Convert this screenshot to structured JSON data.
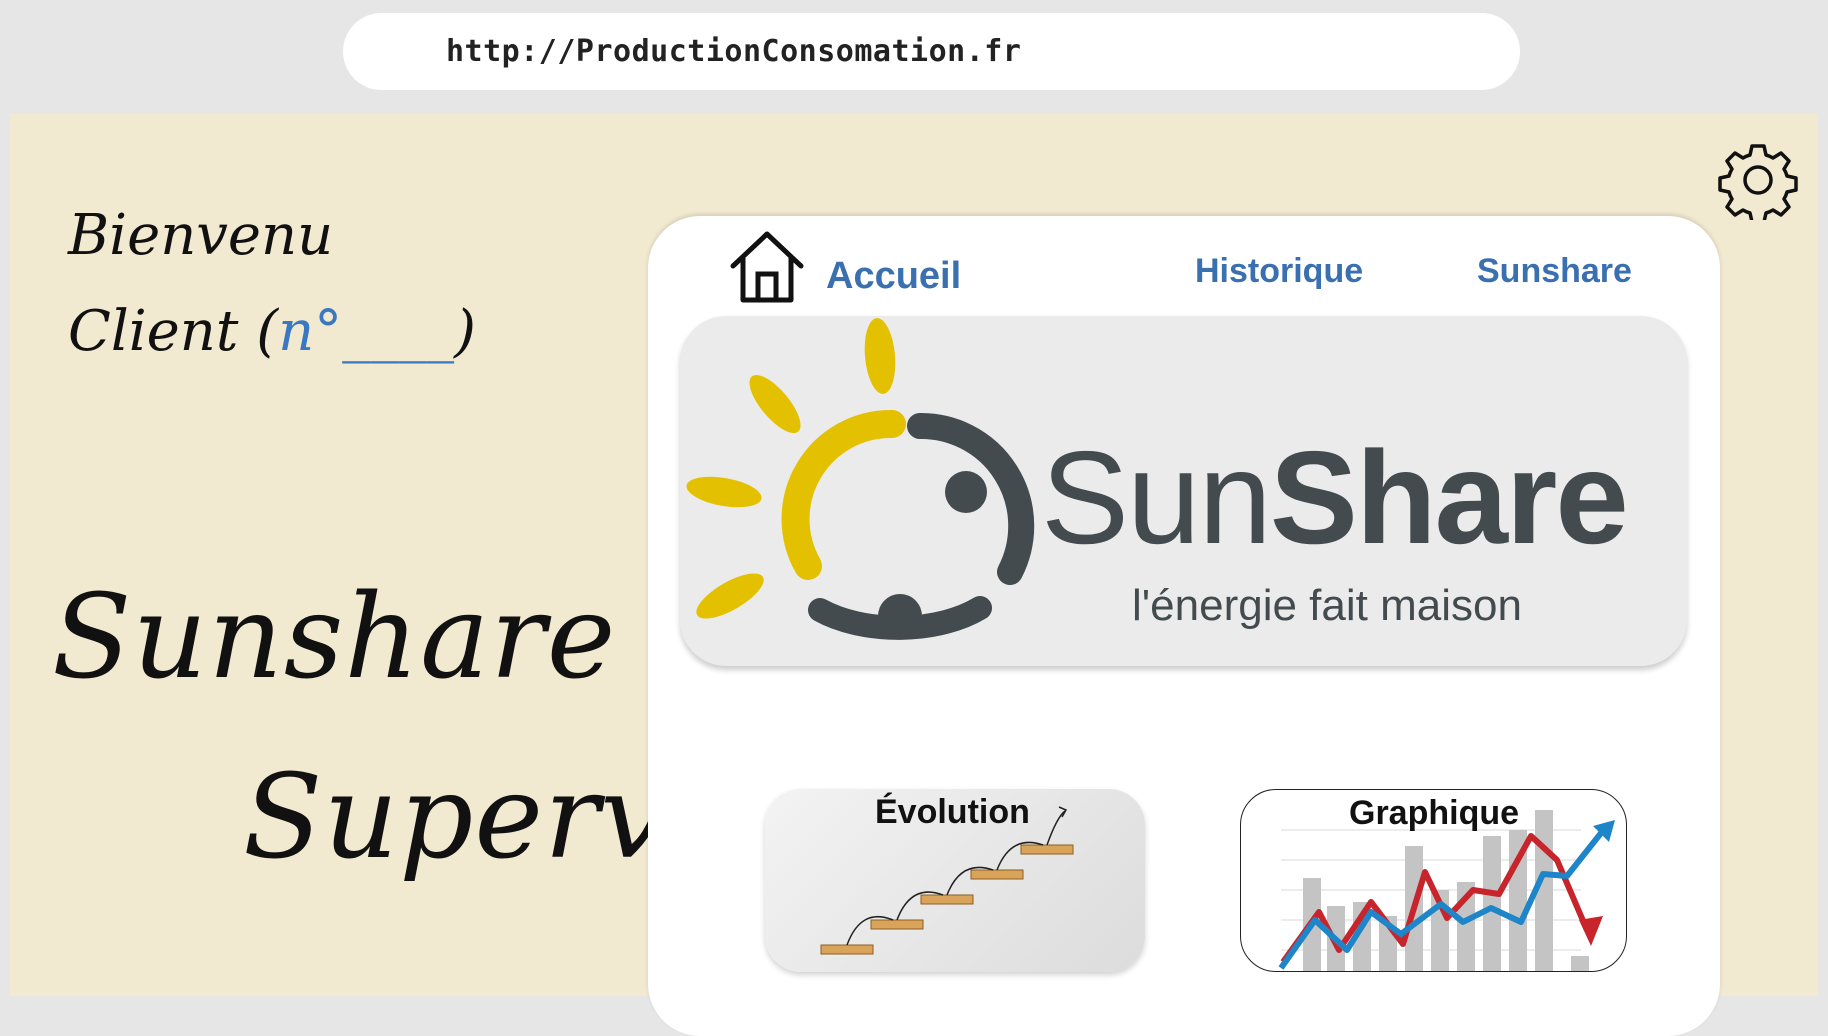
{
  "url_bar": {
    "url": "http://ProductionConsomation.fr"
  },
  "welcome": {
    "line1": "Bienvenu",
    "client_label": "Client",
    "client_open": "(",
    "client_number": "n°____",
    "client_close": ")"
  },
  "brand": {
    "line1": "Sunshare",
    "line2": "Supervisor"
  },
  "nav": {
    "home_label": "Accueil",
    "history_label": "Historique",
    "sunshare_label": "Sunshare"
  },
  "banner": {
    "logo_word_light": "Sun",
    "logo_word_bold": "Share",
    "tagline": "l'énergie fait maison"
  },
  "tiles": {
    "evolution_title": "Évolution",
    "graph_title": "Graphique"
  },
  "icons": {
    "settings": "gear-icon",
    "home": "home-icon"
  },
  "colors": {
    "stage_bg": "#f2e9d1",
    "link_blue": "#3a6fb0",
    "sun_yellow": "#e3c100",
    "logo_gray": "#434b4f"
  }
}
